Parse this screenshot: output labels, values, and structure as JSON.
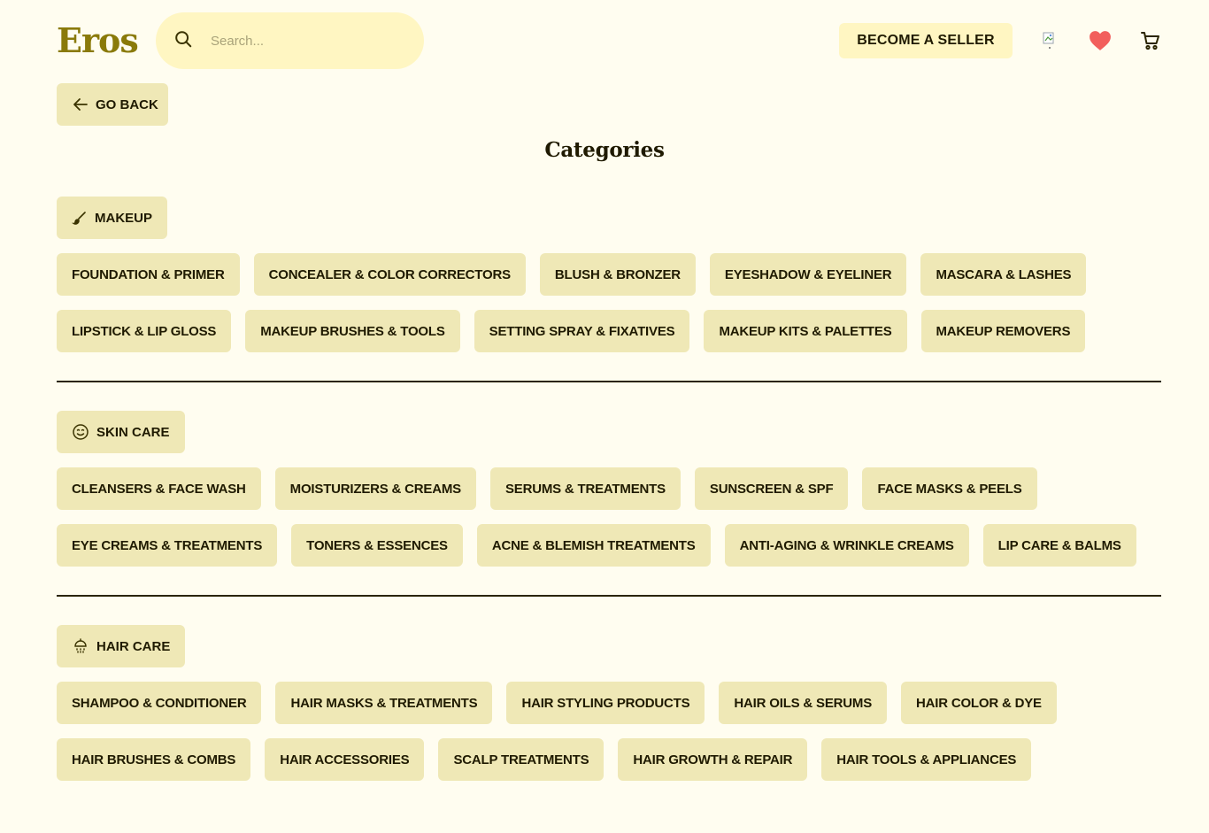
{
  "header": {
    "logo": "Eros",
    "search_placeholder": "Search...",
    "seller_button": "BECOME A SELLER",
    "avatar_icon": "avatar-icon",
    "heart_icon": "heart-icon",
    "cart_icon": "cart-icon"
  },
  "colors": {
    "background": "#fffdf0",
    "chip": "#efe8b6",
    "search": "#fff6c2",
    "logo": "#8a7a0a",
    "heart": "#f25f5c"
  },
  "go_back": "GO BACK",
  "page_title": "Categories",
  "sections": [
    {
      "title": "MAKEUP",
      "icon": "brush-icon",
      "rows": [
        [
          "FOUNDATION & PRIMER",
          "CONCEALER & COLOR CORRECTORS",
          "BLUSH & BRONZER",
          "EYESHADOW & EYELINER",
          "MASCARA & LASHES"
        ],
        [
          "LIPSTICK & LIP GLOSS",
          "MAKEUP BRUSHES & TOOLS",
          "SETTING SPRAY & FIXATIVES",
          "MAKEUP KITS & PALETTES",
          "MAKEUP REMOVERS"
        ]
      ]
    },
    {
      "title": "SKIN CARE",
      "icon": "smile-icon",
      "rows": [
        [
          "CLEANSERS & FACE WASH",
          "MOISTURIZERS & CREAMS",
          "SERUMS & TREATMENTS",
          "SUNSCREEN & SPF",
          "FACE MASKS & PEELS"
        ],
        [
          "EYE CREAMS & TREATMENTS",
          "TONERS & ESSENCES",
          "ACNE & BLEMISH TREATMENTS",
          "ANTI-AGING & WRINKLE CREAMS",
          "LIP CARE & BALMS"
        ]
      ]
    },
    {
      "title": "HAIR CARE",
      "icon": "shower-icon",
      "rows": [
        [
          "SHAMPOO & CONDITIONER",
          "HAIR MASKS & TREATMENTS",
          "HAIR STYLING PRODUCTS",
          "HAIR OILS & SERUMS",
          "HAIR COLOR & DYE"
        ],
        [
          "HAIR BRUSHES & COMBS",
          "HAIR ACCESSORIES",
          "SCALP TREATMENTS",
          "HAIR GROWTH & REPAIR",
          "HAIR TOOLS & APPLIANCES"
        ]
      ]
    }
  ]
}
